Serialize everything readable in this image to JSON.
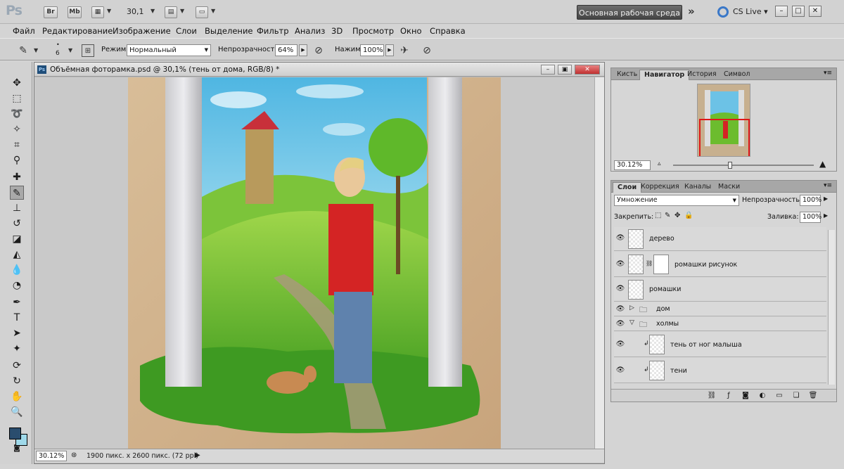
{
  "appbar": {
    "logo": "Ps",
    "br": "Br",
    "mb": "Mb",
    "zoom": "30,1",
    "workspace": "Основная рабочая среда",
    "chevrons": "»",
    "cslive": "CS Live"
  },
  "menu": [
    "Файл",
    "Редактирование",
    "Изображение",
    "Слои",
    "Выделение",
    "Фильтр",
    "Анализ",
    "3D",
    "Просмотр",
    "Окно",
    "Справка"
  ],
  "options": {
    "brush_size": "6",
    "mode_label": "Режим:",
    "mode_value": "Нормальный",
    "opacity_label": "Непрозрачность:",
    "opacity_value": "64%",
    "flow_label": "Нажим:",
    "flow_value": "100%"
  },
  "document": {
    "title": "Объёмная фоторамка.psd @ 30,1% (тень от дома, RGB/8) *",
    "icon": "Ps",
    "status_zoom": "30.12%",
    "status_info": "1900 пикс. x 2600 пикс. (72 ppi)"
  },
  "navigator": {
    "tabs": [
      "Кисть",
      "Навигатор",
      "История",
      "Символ"
    ],
    "active_tab": 1,
    "zoom": "30.12%"
  },
  "layers": {
    "tabs": [
      "Слои",
      "Коррекция",
      "Каналы",
      "Маски"
    ],
    "blend_mode": "Умножение",
    "opacity_label": "Непрозрачность:",
    "opacity_value": "100%",
    "lock_label": "Закрепить:",
    "fill_label": "Заливка:",
    "fill_value": "100%",
    "items": [
      {
        "name": "дерево"
      },
      {
        "name": "ромашки рисунок"
      },
      {
        "name": "ромашки"
      },
      {
        "name": "дом"
      },
      {
        "name": "холмы"
      },
      {
        "name": "тень от ног малыша"
      },
      {
        "name": "тени"
      }
    ]
  },
  "colors": {
    "foreground": "#2a4d6e",
    "background": "#9fd9ea",
    "accent": "#3a78c8"
  }
}
